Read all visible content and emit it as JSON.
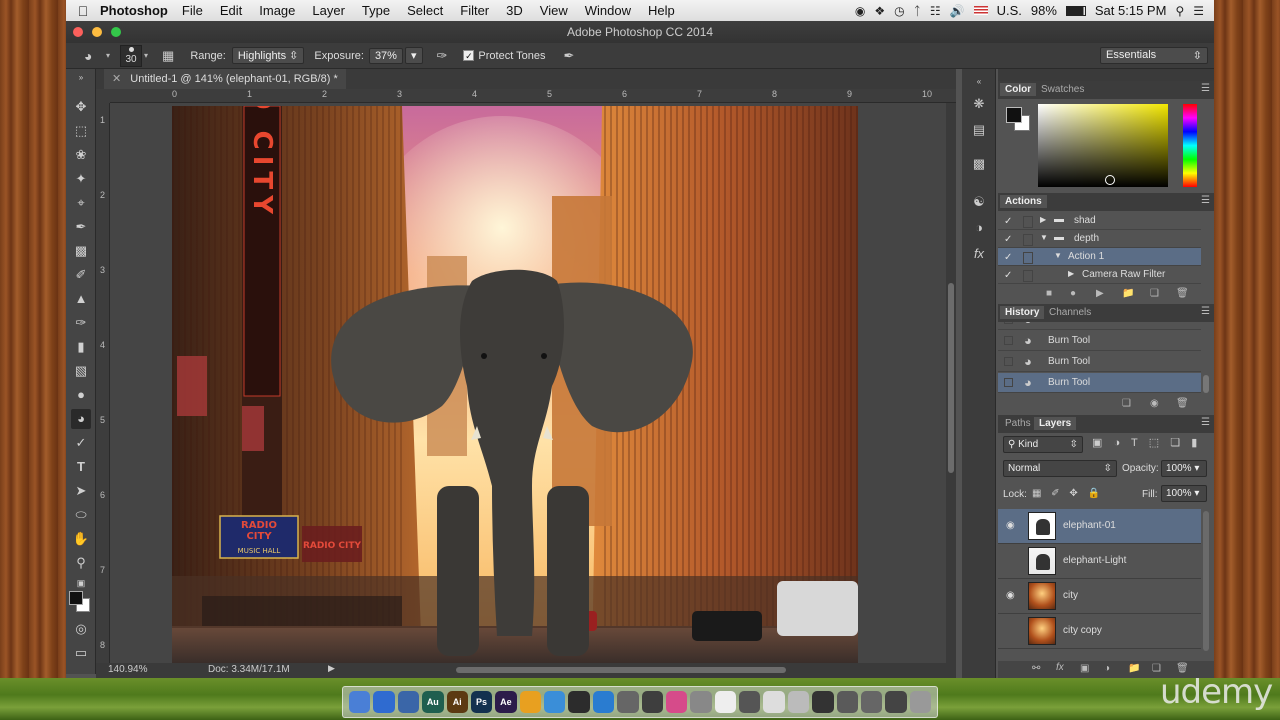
{
  "menubar": {
    "app": "Photoshop",
    "items": [
      "File",
      "Edit",
      "Image",
      "Layer",
      "Type",
      "Select",
      "Filter",
      "3D",
      "View",
      "Window",
      "Help"
    ],
    "input_source": "U.S.",
    "battery": "98%",
    "clock": "Sat 5:15 PM"
  },
  "window": {
    "title": "Adobe Photoshop CC 2014"
  },
  "options": {
    "brush_size": "30",
    "range_label": "Range:",
    "range_value": "Highlights",
    "exposure_label": "Exposure:",
    "exposure_value": "37%",
    "protect_tones": "Protect Tones",
    "workspace": "Essentials"
  },
  "document": {
    "tab": "Untitled-1 @ 141% (elephant-01, RGB/8) *",
    "zoom": "140.94%",
    "doc_size": "Doc: 3.34M/17.1M"
  },
  "image_text": {
    "sign_vertical": "RADIO CITY",
    "marquee_top": "RADIO",
    "marquee_mid": "CITY",
    "marquee_bottom": "MUSIC HALL",
    "side_sign": "RADIO CITY"
  },
  "rulers": {
    "h": [
      "0",
      "1",
      "2",
      "3",
      "4",
      "5",
      "6",
      "7",
      "8",
      "9",
      "10"
    ],
    "v": [
      "1",
      "2",
      "3",
      "4",
      "5",
      "6",
      "7",
      "8"
    ]
  },
  "color_panel": {
    "tabs": [
      "Color",
      "Swatches"
    ]
  },
  "actions_panel": {
    "title": "Actions",
    "rows": [
      {
        "label": "shad",
        "kind": "folder",
        "indent": 0
      },
      {
        "label": "depth",
        "kind": "folder-open",
        "indent": 0
      },
      {
        "label": "Action 1",
        "kind": "action",
        "indent": 1,
        "selected": true
      },
      {
        "label": "Camera Raw Filter",
        "kind": "step",
        "indent": 2
      }
    ]
  },
  "history_panel": {
    "tabs": [
      "History",
      "Channels"
    ],
    "rows": [
      "Burn Tool",
      "Burn Tool",
      "Burn Tool",
      "Burn Tool"
    ]
  },
  "layers_panel": {
    "tabs": [
      "Paths",
      "Layers"
    ],
    "filter": "Kind",
    "blend_mode": "Normal",
    "opacity_label": "Opacity:",
    "opacity": "100%",
    "lock_label": "Lock:",
    "fill_label": "Fill:",
    "fill": "100%",
    "layers": [
      {
        "name": "elephant-01",
        "visible": true,
        "selected": true
      },
      {
        "name": "elephant-Light",
        "visible": false,
        "selected": false
      },
      {
        "name": "city",
        "visible": true,
        "selected": false
      },
      {
        "name": "city copy",
        "visible": false,
        "selected": false
      }
    ]
  },
  "watermark": "udemy",
  "dock": {
    "apps": [
      {
        "label": "",
        "color": "#4a7fd6"
      },
      {
        "label": "",
        "color": "#2f6bd0"
      },
      {
        "label": "",
        "color": "#3a66a8"
      },
      {
        "label": "Au",
        "color": "#1f5f4f"
      },
      {
        "label": "Ai",
        "color": "#5c3a12"
      },
      {
        "label": "Ps",
        "color": "#13314f"
      },
      {
        "label": "Ae",
        "color": "#2c1c4a"
      },
      {
        "label": "",
        "color": "#e8a020"
      },
      {
        "label": "",
        "color": "#3a8ed8"
      },
      {
        "label": "",
        "color": "#2c2c2c"
      },
      {
        "label": "",
        "color": "#2a7cd0"
      },
      {
        "label": "",
        "color": "#666"
      },
      {
        "label": "",
        "color": "#3e3e3e"
      },
      {
        "label": "",
        "color": "#d64b8a"
      },
      {
        "label": "",
        "color": "#888"
      },
      {
        "label": "",
        "color": "#eeeeee"
      },
      {
        "label": "",
        "color": "#555"
      },
      {
        "label": "",
        "color": "#ddd"
      },
      {
        "label": "",
        "color": "#bbb"
      },
      {
        "label": "",
        "color": "#333"
      },
      {
        "label": "",
        "color": "#5a5a5a"
      },
      {
        "label": "",
        "color": "#666"
      },
      {
        "label": "",
        "color": "#444"
      },
      {
        "label": "",
        "color": "#999"
      }
    ]
  }
}
